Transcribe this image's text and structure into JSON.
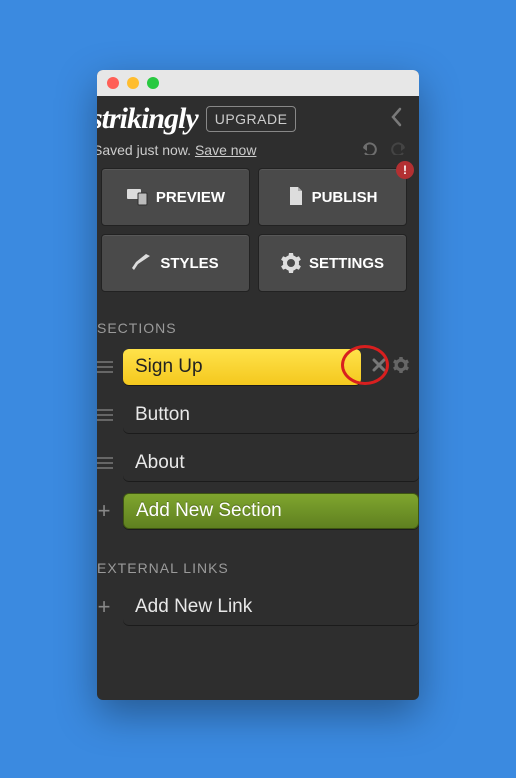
{
  "logo_text": "strikingly",
  "upgrade_label": "UPGRADE",
  "save_status": "Saved just now.",
  "save_now_label": "Save now",
  "buttons": {
    "preview": "PREVIEW",
    "publish": "PUBLISH",
    "styles": "STYLES",
    "settings": "SETTINGS",
    "alert_badge": "!"
  },
  "headings": {
    "sections": "SECTIONS",
    "external_links": "EXTERNAL LINKS"
  },
  "sections": [
    {
      "label": "Sign Up",
      "active": true
    },
    {
      "label": "Button"
    },
    {
      "label": "About"
    }
  ],
  "add_section_label": "Add New Section",
  "add_link_label": "Add New Link"
}
